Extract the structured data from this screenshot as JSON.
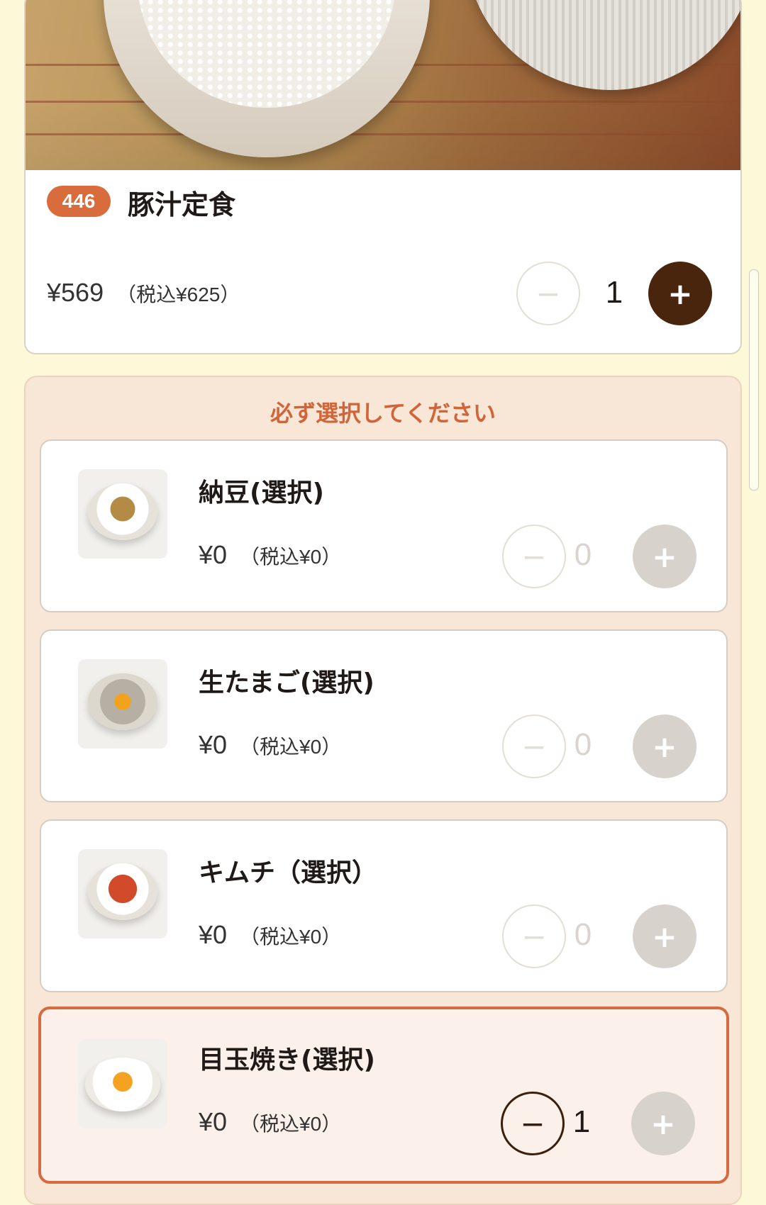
{
  "main_item": {
    "code": "446",
    "name": "豚汁定食",
    "price": "¥569",
    "price_tax": "（税込¥625）",
    "quantity": "1"
  },
  "options": {
    "prompt": "必ず選択してください",
    "items": [
      {
        "name": "納豆(選択)",
        "price": "¥0",
        "price_tax": "（税込¥0）",
        "quantity": "0"
      },
      {
        "name": "生たまご(選択)",
        "price": "¥0",
        "price_tax": "（税込¥0）",
        "quantity": "0"
      },
      {
        "name": "キムチ（選択）",
        "price": "¥0",
        "price_tax": "（税込¥0）",
        "quantity": "0"
      },
      {
        "name": "目玉焼き(選択)",
        "price": "¥0",
        "price_tax": "（税込¥0）",
        "quantity": "1",
        "selected": true
      }
    ]
  },
  "icons": {
    "minus": "minus-icon",
    "plus": "plus-icon"
  },
  "colors": {
    "accent": "#d96c3c",
    "dark_brown": "#4a250e",
    "background": "#fdf8d8",
    "options_panel": "#f8e7d6"
  }
}
